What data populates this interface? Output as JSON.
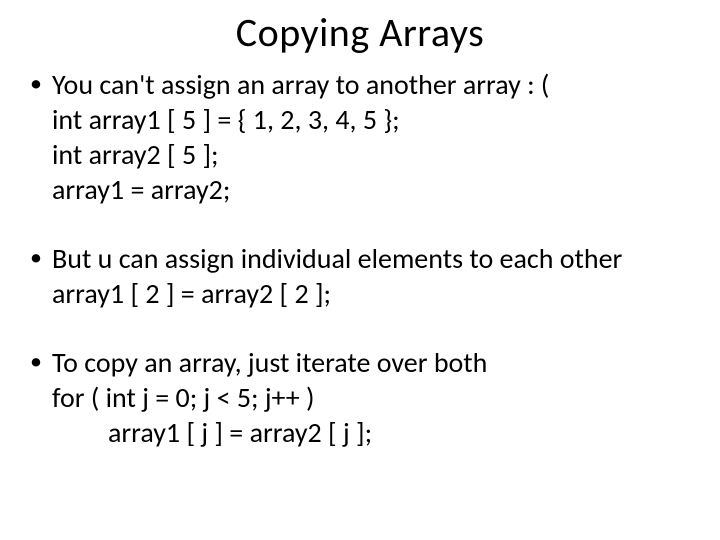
{
  "title": "Copying Arrays",
  "bullets": [
    {
      "lead": "You can't assign an array to another array : (",
      "lines": [
        "int array1 [ 5 ] = { 1, 2, 3, 4, 5 };",
        "int array2 [ 5 ];",
        "array1 = array2;"
      ]
    },
    {
      "lead": "But u can assign individual elements to each other",
      "lines": [
        "array1 [ 2 ] = array2 [ 2 ];"
      ]
    },
    {
      "lead": "To copy an array, just iterate over both",
      "lines": [
        "for ( int j = 0; j < 5; j++ )"
      ],
      "indentLines": [
        "array1 [ j ] = array2 [ j ];"
      ]
    }
  ]
}
